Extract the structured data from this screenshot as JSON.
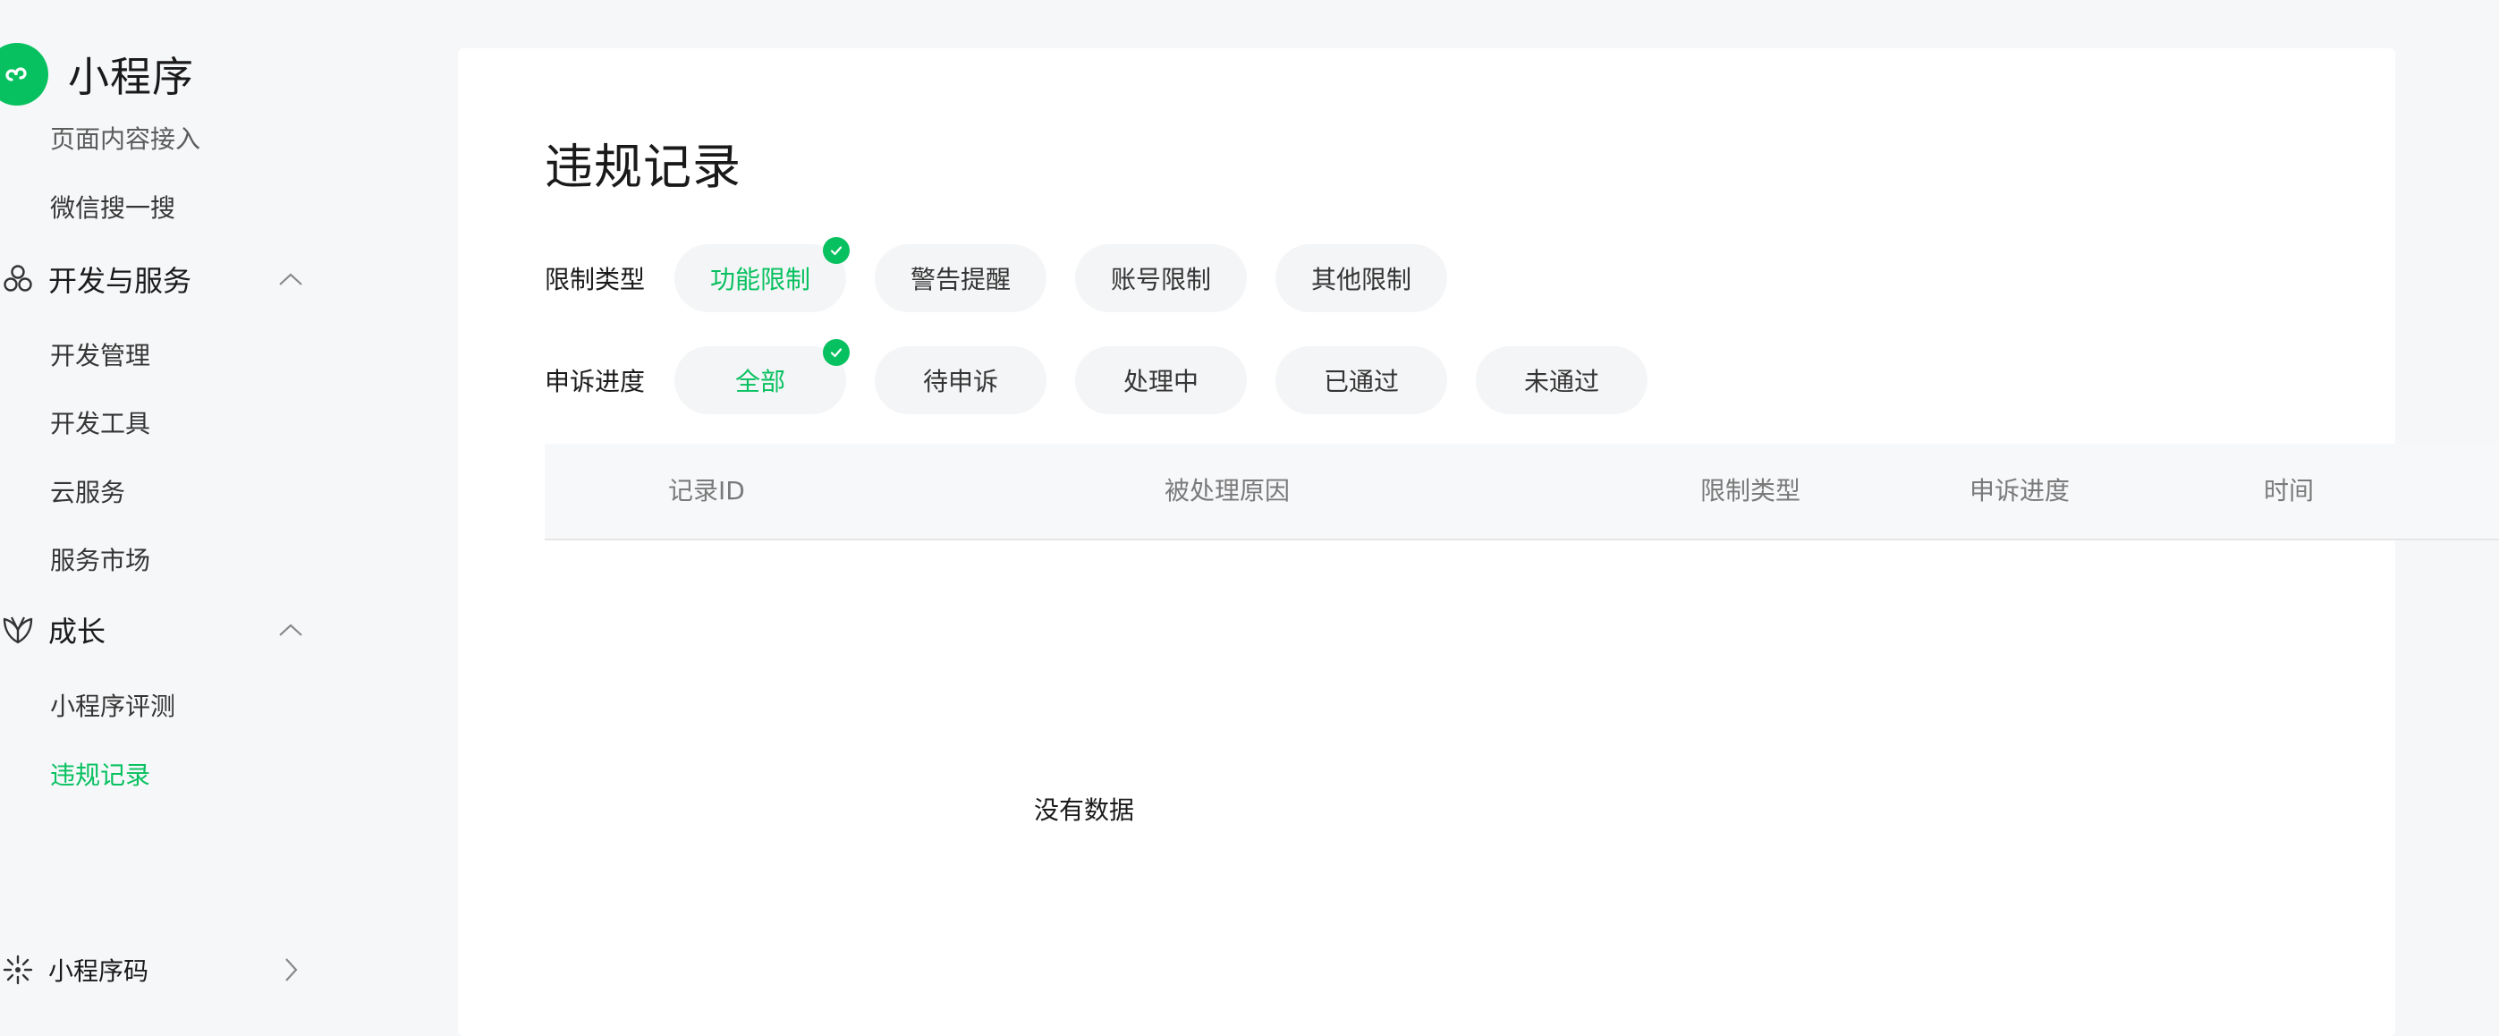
{
  "brand": {
    "title": "小程序"
  },
  "sidebar": {
    "clipped_item": "页面内容接入",
    "item_wechat_search": "微信搜一搜",
    "group_dev": "开发与服务",
    "dev_items": [
      "开发管理",
      "开发工具",
      "云服务",
      "服务市场"
    ],
    "group_growth": "成长",
    "growth_items": [
      "小程序评测",
      "违规记录"
    ],
    "qr_code": "小程序码"
  },
  "main": {
    "title": "违规记录",
    "filter_type": {
      "label": "限制类型",
      "options": [
        "功能限制",
        "警告提醒",
        "账号限制",
        "其他限制"
      ],
      "selected": "功能限制"
    },
    "filter_progress": {
      "label": "申诉进度",
      "options": [
        "全部",
        "待申诉",
        "处理中",
        "已通过",
        "未通过"
      ],
      "selected": "全部"
    },
    "table": {
      "columns": [
        "记录ID",
        "被处理原因",
        "限制类型",
        "申诉进度",
        "时间"
      ],
      "empty_text": "没有数据"
    }
  },
  "colors": {
    "accent": "#07c160",
    "page_bg": "#f6f7f9",
    "card_bg": "#ffffff",
    "pill_bg": "#f4f5f6"
  }
}
